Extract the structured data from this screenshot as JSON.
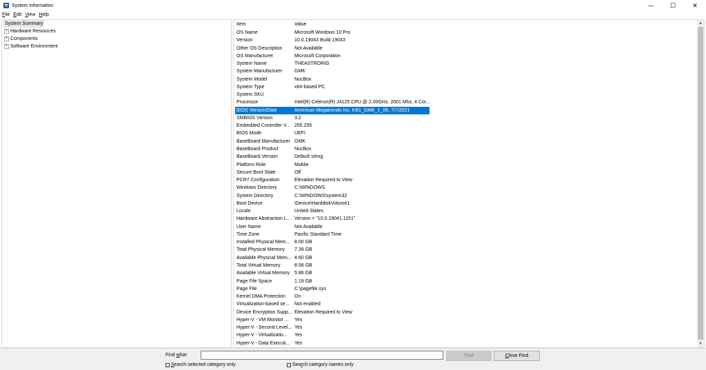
{
  "window": {
    "title": "System Information",
    "minimize_glyph": "—",
    "maximize_glyph": "☐",
    "close_glyph": "✕"
  },
  "menu": [
    {
      "acc": "F",
      "rest": "ile"
    },
    {
      "acc": "E",
      "rest": "dit"
    },
    {
      "acc": "V",
      "rest": "iew"
    },
    {
      "acc": "H",
      "rest": "elp"
    }
  ],
  "tree": {
    "root": "System Summary",
    "children": [
      "Hardware Resources",
      "Components",
      "Software Environment"
    ],
    "expander_glyph": "+"
  },
  "list": {
    "headers": {
      "item": "Item",
      "value": "Value"
    },
    "selected_index": 11,
    "rows": [
      {
        "item": "OS Name",
        "value": "Microsoft Windows 10 Pro"
      },
      {
        "item": "Version",
        "value": "10.0.19043 Build 19043"
      },
      {
        "item": "Other OS Description",
        "value": "Not Available"
      },
      {
        "item": "OS Manufacturer",
        "value": "Microsoft Corporation"
      },
      {
        "item": "System Name",
        "value": "THEASTRORIG"
      },
      {
        "item": "System Manufacturer",
        "value": "GMK"
      },
      {
        "item": "System Model",
        "value": "NucBox"
      },
      {
        "item": "System Type",
        "value": "x64-based PC"
      },
      {
        "item": "System SKU",
        "value": ""
      },
      {
        "item": "Processor",
        "value": "Intel(R) Celeron(R) J4125 CPU @ 2.00GHz, 2001 Mhz, 4 Cor..."
      },
      {
        "item": "BIOS Version/Date",
        "value": "American Megatrends Inc. KB1_GMK_1_06, 7/7/2021"
      },
      {
        "item": "SMBIOS Version",
        "value": "3.2"
      },
      {
        "item": "Embedded Controller V...",
        "value": "255.255"
      },
      {
        "item": "BIOS Mode",
        "value": "UEFI"
      },
      {
        "item": "BaseBoard Manufacturer",
        "value": "GMK"
      },
      {
        "item": "BaseBoard Product",
        "value": "NucBox"
      },
      {
        "item": "BaseBoard Version",
        "value": "Default string"
      },
      {
        "item": "Platform Role",
        "value": "Mobile"
      },
      {
        "item": "Secure Boot State",
        "value": "Off"
      },
      {
        "item": "PCR7 Configuration",
        "value": "Elevation Required to View"
      },
      {
        "item": "Windows Directory",
        "value": "C:\\WINDOWS"
      },
      {
        "item": "System Directory",
        "value": "C:\\WINDOWS\\system32"
      },
      {
        "item": "Boot Device",
        "value": "\\Device\\HarddiskVolume1"
      },
      {
        "item": "Locale",
        "value": "United States"
      },
      {
        "item": "Hardware Abstraction L...",
        "value": "Version = \"10.0.19041.1151\""
      },
      {
        "item": "User Name",
        "value": "Not Available"
      },
      {
        "item": "Time Zone",
        "value": "Pacific Standard Time"
      },
      {
        "item": "Installed Physical Mem...",
        "value": "8.00 GB"
      },
      {
        "item": "Total Physical Memory",
        "value": "7.39 GB"
      },
      {
        "item": "Available Physical Mem...",
        "value": "4.60 GB"
      },
      {
        "item": "Total Virtual Memory",
        "value": "8.58 GB"
      },
      {
        "item": "Available Virtual Memory",
        "value": "5.86 GB"
      },
      {
        "item": "Page File Space",
        "value": "1.19 GB"
      },
      {
        "item": "Page File",
        "value": "C:\\pagefile.sys"
      },
      {
        "item": "Kernel DMA Protection",
        "value": "On"
      },
      {
        "item": "Virtualization-based se...",
        "value": "Not enabled"
      },
      {
        "item": "Device Encryption Supp...",
        "value": "Elevation Required to View"
      },
      {
        "item": "Hyper-V - VM Monitor ...",
        "value": "Yes"
      },
      {
        "item": "Hyper-V - Second Level...",
        "value": "Yes"
      },
      {
        "item": "Hyper-V - Virtualizatio...",
        "value": "Yes"
      },
      {
        "item": "Hyper-V - Data Executi...",
        "value": "Yes"
      }
    ]
  },
  "scrollbar": {
    "up_glyph": "▲",
    "down_glyph": "▼"
  },
  "find": {
    "label_acc": "w",
    "label_pre": "Find ",
    "label_post": "hat:",
    "input_value": "",
    "find_button": "Find",
    "close_acc": "C",
    "close_rest": "lose Find",
    "check1_acc": "S",
    "check1_rest": "earch selected category only",
    "check2_pre": "Sea",
    "check2_acc": "r",
    "check2_post": "ch category names only"
  },
  "colors": {
    "selection": "#0078d7"
  }
}
